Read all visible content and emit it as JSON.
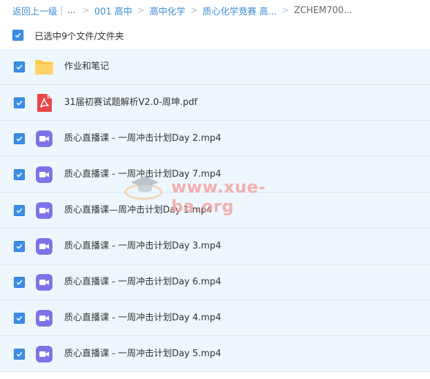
{
  "breadcrumb": {
    "back": "返回上一级",
    "ellipsis": "...",
    "items": [
      "001 高中",
      "高中化学",
      "质心化学竞赛 高..."
    ],
    "current": "ZCHEM700..."
  },
  "selection": {
    "label": "已选中9个文件/文件夹",
    "checked": true
  },
  "files": [
    {
      "name": "作业和笔记",
      "type": "folder"
    },
    {
      "name": "31届初赛试题解析V2.0-周坤.pdf",
      "type": "pdf"
    },
    {
      "name": "质心直播课 - 一周冲击计划Day 2.mp4",
      "type": "video"
    },
    {
      "name": "质心直播课 - 一周冲击计划Day 7.mp4",
      "type": "video"
    },
    {
      "name": "质心直播课—周冲击计划Day 1.mp4",
      "type": "video"
    },
    {
      "name": "质心直播课 - 一周冲击计划Day 3.mp4",
      "type": "video"
    },
    {
      "name": "质心直播课 - 一周冲击计划Day 6.mp4",
      "type": "video"
    },
    {
      "name": "质心直播课 - 一周冲击计划Day 4.mp4",
      "type": "video"
    },
    {
      "name": "质心直播课 - 一周冲击计划Day 5.mp4",
      "type": "video"
    }
  ],
  "watermark": {
    "text": "www.xue-ba.org"
  },
  "icons": {
    "checkbox": "checkbox-checked-icon",
    "folder": "folder-icon",
    "pdf": "pdf-file-icon",
    "video": "video-file-icon"
  },
  "colors": {
    "link": "#3b8cd6",
    "row_bg": "#eef7fe",
    "checkbox": "#3b8ee8",
    "folder": "#fcc94a",
    "pdf": "#e94646",
    "video": "#7e73e6",
    "watermark": "#f4a3a3"
  }
}
